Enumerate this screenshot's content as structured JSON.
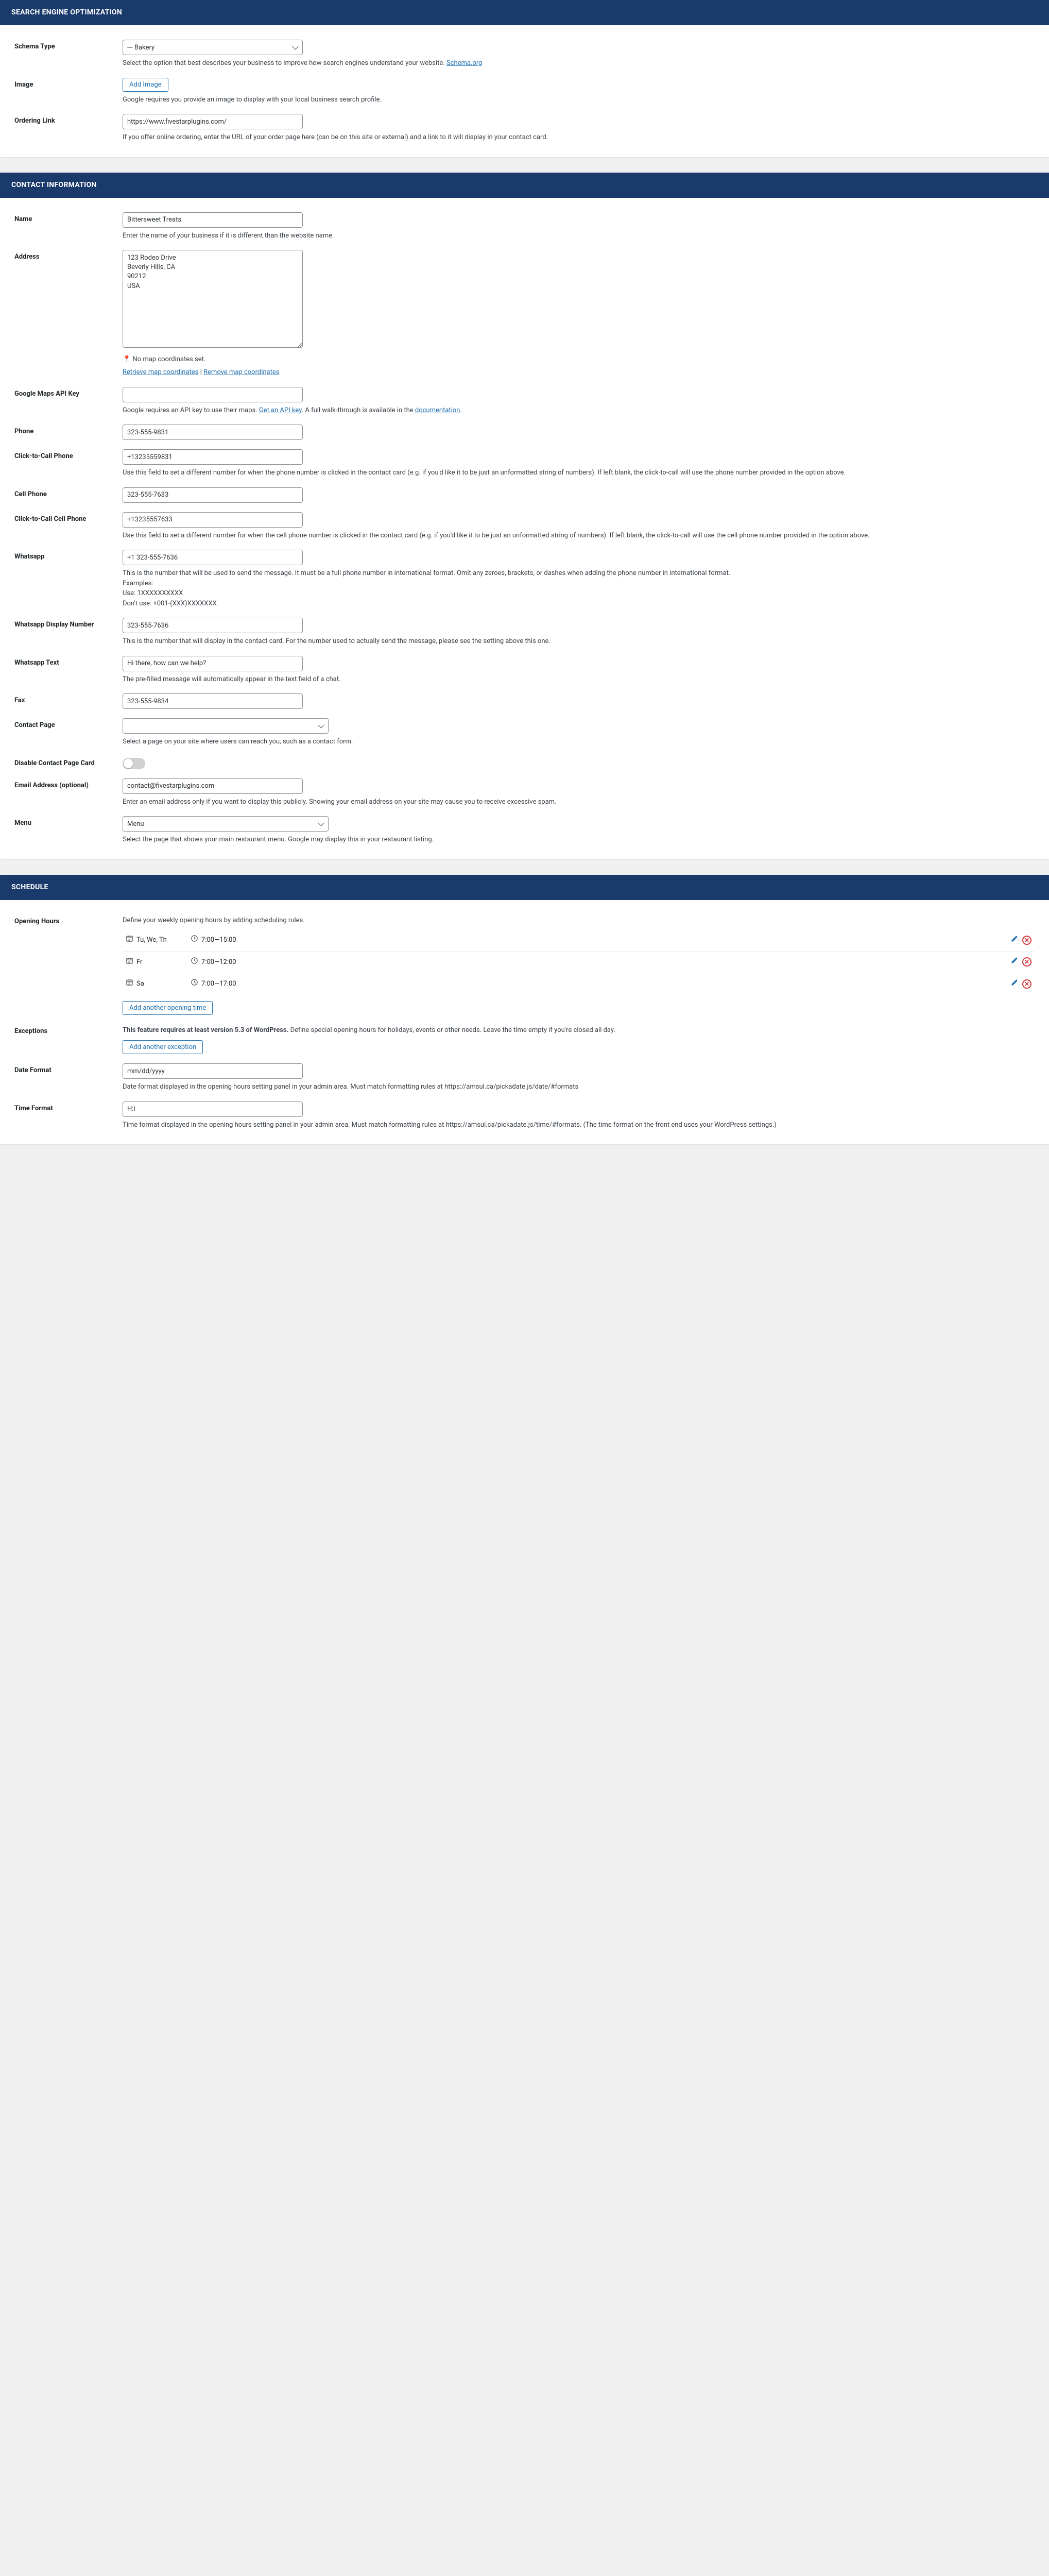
{
  "seo": {
    "title": "SEARCH ENGINE OPTIMIZATION",
    "schema_type": {
      "label": "Schema Type",
      "value": "--- Bakery",
      "help_pre": "Select the option that best describes your business to improve how search engines understand your website. ",
      "help_link": "Schema.org"
    },
    "image": {
      "label": "Image",
      "btn": "Add Image",
      "help": "Google requires you provide an image to display with your local business search profile."
    },
    "ordering": {
      "label": "Ordering Link",
      "value": "https://www.fivestarplugins.com/",
      "help": "If you offer online ordering, enter the URL of your order page here (can be on this site or external) and a link to it will display in your contact card."
    }
  },
  "contact": {
    "title": "CONTACT INFORMATION",
    "name": {
      "label": "Name",
      "value": "Bittersweet Treats",
      "help": "Enter the name of your business if it is different than the website name."
    },
    "address": {
      "label": "Address",
      "value": "123 Rodeo Drive\nBeverly Hills, CA\n90212\nUSA",
      "no_map": "No map coordinates set.",
      "retrieve": "Retrieve map coordinates",
      "sep": " | ",
      "remove": "Remove map coordinates"
    },
    "api_key": {
      "label": "Google Maps API Key",
      "value": "",
      "help_pre": "Google requires an API key to use their maps. ",
      "help_link": "Get an API key",
      "help_post": ". A full walk-through is available in the ",
      "help_link2": "documentation",
      "help_post2": "."
    },
    "phone": {
      "label": "Phone",
      "value": "323-555-9831"
    },
    "ctc_phone": {
      "label": "Click-to-Call Phone",
      "value": "+13235559831",
      "help": "Use this field to set a different number for when the phone number is clicked in the contact card (e.g. if you'd like it to be just an unformatted string of numbers). If left blank, the click-to-call will use the phone number provided in the option above."
    },
    "cell": {
      "label": "Cell Phone",
      "value": "323-555-7633"
    },
    "ctc_cell": {
      "label": "Click-to-Call Cell Phone",
      "value": "+13235557633",
      "help": "Use this field to set a different number for when the cell phone number is clicked in the contact card (e.g. if you'd like it to be just an unformatted string of numbers). If left blank, the click-to-call will use the cell phone number provided in the option above."
    },
    "whatsapp": {
      "label": "Whatsapp",
      "value": "+1 323-555-7636",
      "help1": "This is the number that will be used to send the message. It must be a full phone number in international format. Omit any zeroes, brackets, or dashes when adding the phone number in international format.",
      "help2": "Examples:",
      "help3": "Use: 1XXXXXXXXXX",
      "help4": "Don't use: +001-(XXX)XXXXXXX"
    },
    "whatsapp_display": {
      "label": "Whatsapp Display Number",
      "value": "323-555-7636",
      "help": "This is the number that will display in the contact card. For the number used to actually send the message, please see the setting above this one."
    },
    "whatsapp_text": {
      "label": "Whatsapp Text",
      "value": "Hi there, how can we help?",
      "help": "The pre-filled message will automatically appear in the text field of a chat."
    },
    "fax": {
      "label": "Fax",
      "value": "323-555-9834"
    },
    "contact_page": {
      "label": "Contact Page",
      "value": "",
      "help": "Select a page on your site where users can reach you, such as a contact form."
    },
    "disable_card": {
      "label": "Disable Contact Page Card"
    },
    "email": {
      "label": "Email Address (optional)",
      "value": "contact@fivestarplugins.com",
      "help": "Enter an email address only if you want to display this publicly. Showing your email address on your site may cause you to receive excessive spam."
    },
    "menu": {
      "label": "Menu",
      "value": "Menu",
      "help": "Select the page that shows your main restaurant menu. Google may display this in your restaurant listing."
    }
  },
  "schedule": {
    "title": "SCHEDULE",
    "opening": {
      "label": "Opening Hours",
      "intro": "Define your weekly opening hours by adding scheduling rules."
    },
    "rules": [
      {
        "days": "Tu, We, Th",
        "time": "7:00—15:00"
      },
      {
        "days": "Fr",
        "time": "7:00—12:00"
      },
      {
        "days": "Sa",
        "time": "7:00—17:00"
      }
    ],
    "add_opening": "Add another opening time",
    "exceptions": {
      "label": "Exceptions",
      "strong": "This feature requires at least version 5.3 of WordPress.",
      "rest": " Define special opening hours for holidays, events or other needs. Leave the time empty if you're closed all day.",
      "btn": "Add another exception"
    },
    "date_format": {
      "label": "Date Format",
      "value": "mm/dd/yyyy",
      "help": "Date format displayed in the opening hours setting panel in your admin area. Must match formatting rules at https://amsul.ca/pickadate.js/date/#formats"
    },
    "time_format": {
      "label": "Time Format",
      "value": "H:i",
      "help": "Time format displayed in the opening hours setting panel in your admin area. Must match formatting rules at https://amsul.ca/pickadate.js/time/#formats. (The time format on the front end uses your WordPress settings.)"
    }
  }
}
